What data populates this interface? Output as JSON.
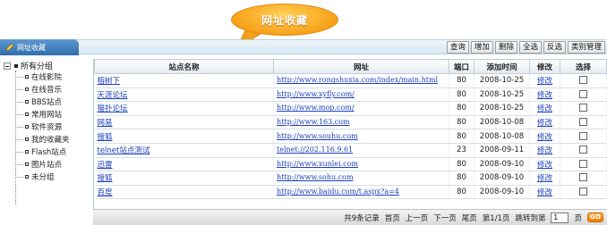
{
  "bubble": {
    "title": "网址收藏"
  },
  "header": {
    "title": "网址收藏"
  },
  "toolbar": {
    "query": "查询",
    "add": "增加",
    "delete": "删除",
    "select_all": "全选",
    "invert": "反选",
    "category": "类别管理"
  },
  "tree": {
    "root": "所有分组",
    "items": [
      {
        "label": "在线影院"
      },
      {
        "label": "在线音乐"
      },
      {
        "label": "BBS站点"
      },
      {
        "label": "常用网站"
      },
      {
        "label": "软件资源"
      },
      {
        "label": "我的收藏夹"
      },
      {
        "label": "Flash站点"
      },
      {
        "label": "图片站点"
      },
      {
        "label": "未分组"
      }
    ]
  },
  "table": {
    "headers": {
      "name": "站点名称",
      "url": "网址",
      "port": "端口",
      "date": "添加时间",
      "edit": "修改",
      "select": "选择"
    },
    "edit_label": "修改",
    "rows": [
      {
        "name": "榕树下",
        "url": "http://www.rongshuxia.com/index/main.html",
        "port": "80",
        "date": "2008-10-25"
      },
      {
        "name": "天涯论坛",
        "url": "http://www.xyfly.com/",
        "port": "80",
        "date": "2008-10-25"
      },
      {
        "name": "猫扑论坛",
        "url": "http://www.mop.com/",
        "port": "80",
        "date": "2008-10-25"
      },
      {
        "name": "网易",
        "url": "http://www.163.com",
        "port": "80",
        "date": "2008-10-08"
      },
      {
        "name": "搜狐",
        "url": "http://www.souhu.com",
        "port": "80",
        "date": "2008-10-08"
      },
      {
        "name": "telnet站点测试",
        "url": "telnet://202.116.9.61",
        "port": "23",
        "date": "2008-09-11"
      },
      {
        "name": "迅雷",
        "url": "http://www.xunlei.com",
        "port": "80",
        "date": "2008-09-10"
      },
      {
        "name": "搜狐",
        "url": "http://www.sohu.com",
        "port": "80",
        "date": "2008-09-10"
      },
      {
        "name": "百度",
        "url": "http://www.baidu.com/t.aspx?a=4",
        "port": "80",
        "date": "2008-09-10"
      }
    ]
  },
  "pager": {
    "total": "共9条记录",
    "first": "首页",
    "prev": "上一页",
    "next": "下一页",
    "last": "尾页",
    "page_info": "第1/1页",
    "jump_label": "跳转到第",
    "page_value": "1",
    "page_suffix": "页",
    "go": "GO"
  }
}
